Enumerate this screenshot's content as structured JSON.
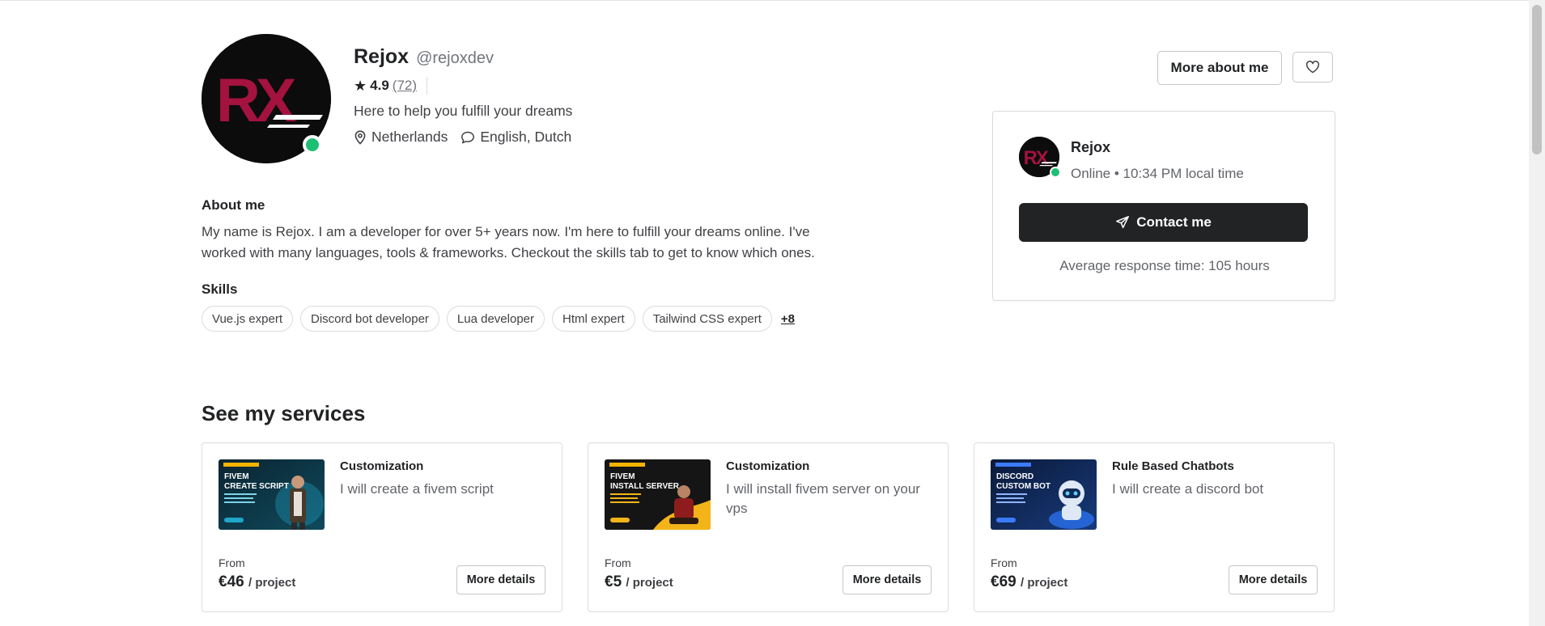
{
  "profile": {
    "name": "Rejox",
    "username": "@rejoxdev",
    "rating": "4.9",
    "reviews": "(72)",
    "tagline": "Here to help you fulfill your dreams",
    "location": "Netherlands",
    "languages": "English, Dutch",
    "avatar_text": "RX"
  },
  "header_buttons": {
    "more_about": "More about me"
  },
  "about": {
    "heading": "About me",
    "text": "My name is Rejox. I am a developer for over 5+ years now. I'm here to fulfill your dreams online. I've worked with many languages, tools & frameworks. Checkout the skills tab to get to know which ones."
  },
  "skills": {
    "heading": "Skills",
    "items": [
      "Vue.js expert",
      "Discord bot developer",
      "Lua developer",
      "Html expert",
      "Tailwind CSS expert"
    ],
    "more": "+8"
  },
  "contact_card": {
    "name": "Rejox",
    "status": "Online • 10:34 PM local time",
    "button": "Contact me",
    "response": "Average response time: 105 hours"
  },
  "services": {
    "heading": "See my services",
    "cards": [
      {
        "category": "Customization",
        "title": "I will create a fivem script",
        "from": "From",
        "price": "€46",
        "unit": "/ project",
        "button": "More details",
        "thumb_line1": "FIVEM",
        "thumb_line2": "CREATE SCRIPT"
      },
      {
        "category": "Customization",
        "title": "I will install fivem server on your vps",
        "from": "From",
        "price": "€5",
        "unit": "/ project",
        "button": "More details",
        "thumb_line1": "FIVEM",
        "thumb_line2": "INSTALL SERVER"
      },
      {
        "category": "Rule Based Chatbots",
        "title": "I will create a discord bot",
        "from": "From",
        "price": "€69",
        "unit": "/ project",
        "button": "More details",
        "thumb_line1": "DISCORD",
        "thumb_line2": "CUSTOM BOT"
      }
    ]
  },
  "colors": {
    "online": "#1dbf73",
    "dark": "#222325",
    "logo": "#a4123f"
  }
}
